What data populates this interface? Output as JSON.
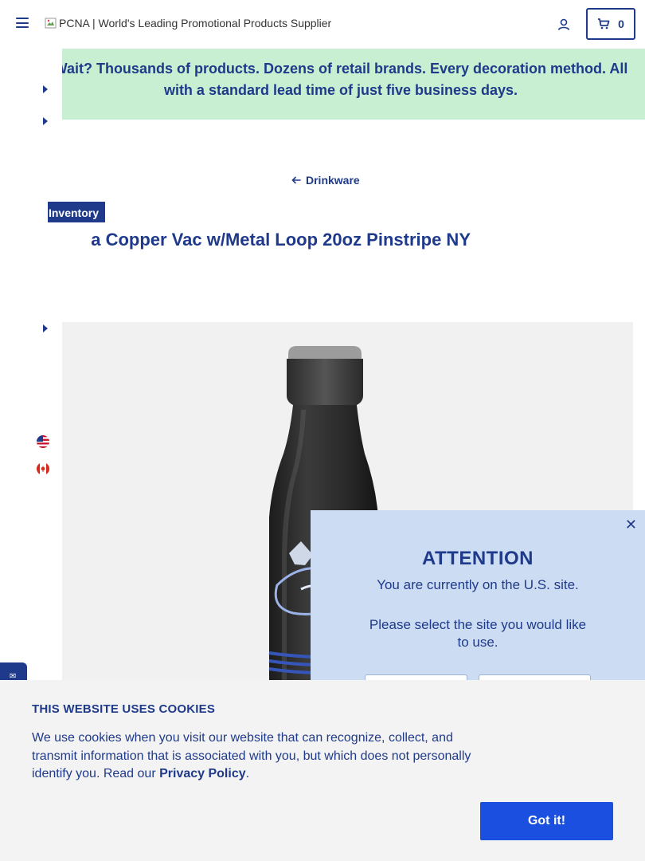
{
  "header": {
    "logo_alt": "PCNA | World's Leading Promotional Products Supplier",
    "cart_count": "0"
  },
  "banner": {
    "line1": "Wait? Thousands of products. Dozens of retail brands. Every decoration method. All",
    "line2": "with a standard lead time of just five business days."
  },
  "breadcrumb": {
    "back_label": "Drinkware"
  },
  "product": {
    "badge": "Inventory",
    "title": "a Copper Vac w/Metal Loop 20oz Pinstripe NY"
  },
  "regions": [
    {
      "name": "United States",
      "icon": "us-flag-icon"
    },
    {
      "name": "Canada",
      "icon": "canada-flag-icon"
    }
  ],
  "modal": {
    "heading": "ATTENTION",
    "current_site": "You are currently on the U.S. site.",
    "prompt": "Please select the site you would like to use."
  },
  "cookies": {
    "title": "THIS WEBSITE USES COOKIES",
    "body": "We use cookies when you visit our website that can recognize, collect, and transmit information that is associated with you, but which does not personally identify you. Read our ",
    "link": "Privacy Policy",
    "after_link": ".",
    "button": "Got it!"
  },
  "colors": {
    "brand_navy": "#1f3a8a",
    "banner_green": "#c8efd2",
    "modal_blue": "#ccdcf3",
    "button_blue": "#1a4fe0"
  }
}
